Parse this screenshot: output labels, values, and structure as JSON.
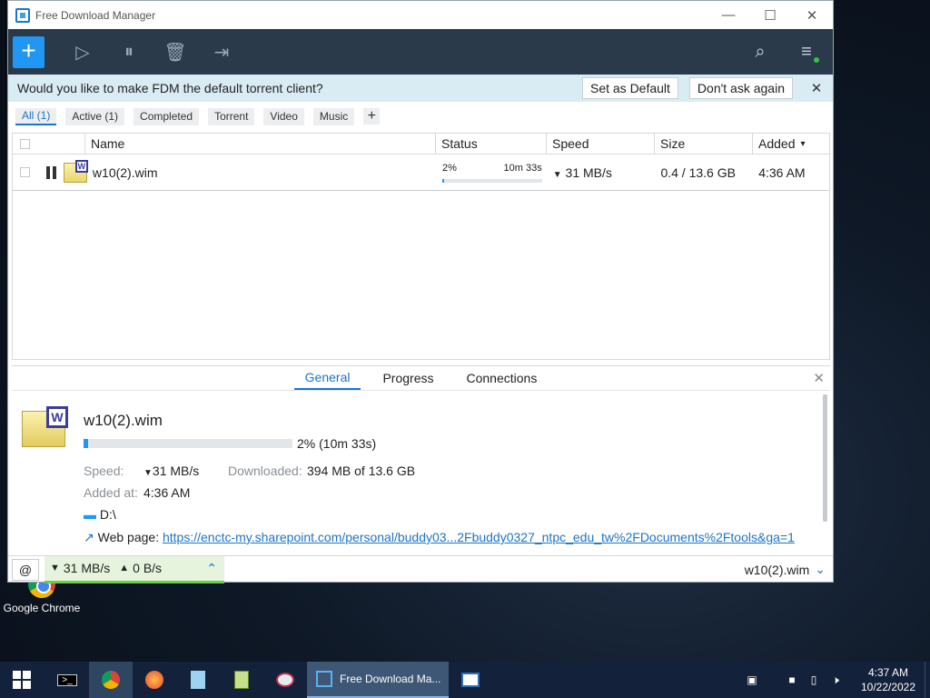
{
  "window": {
    "title": "Free Download Manager",
    "minimize": "—",
    "maximize": "☐",
    "close": "✕"
  },
  "toolbar": {
    "add": "+",
    "start": "▷",
    "pause_all": "⏸",
    "delete": "🗑",
    "move": "⇥",
    "search": "⌕",
    "menu": "≡"
  },
  "banner": {
    "message": "Would you like to make FDM the default torrent client?",
    "set_default": "Set as Default",
    "dont_ask": "Don't ask again",
    "close": "✕"
  },
  "filters": [
    {
      "label": "All (1)",
      "active": true
    },
    {
      "label": "Active (1)",
      "active": false
    },
    {
      "label": "Completed",
      "active": false
    },
    {
      "label": "Torrent",
      "active": false
    },
    {
      "label": "Video",
      "active": false
    },
    {
      "label": "Music",
      "active": false
    }
  ],
  "filter_add": "+",
  "table": {
    "headers": {
      "name": "Name",
      "status": "Status",
      "speed": "Speed",
      "size": "Size",
      "added": "Added"
    },
    "row": {
      "name": "w10(2).wim",
      "percent_text": "2%",
      "eta": "10m 33s",
      "progress": 0.02,
      "speed": "31 MB/s",
      "size": "0.4 / 13.6 GB",
      "added": "4:36 AM"
    }
  },
  "details": {
    "tabs": [
      "General",
      "Progress",
      "Connections"
    ],
    "file_name": "w10(2).wim",
    "progress": 0.02,
    "progress_text": "2% (10m 33s)",
    "speed_label": "Speed:",
    "speed_value": "31 MB/s",
    "downloaded_label": "Downloaded:",
    "downloaded_value": "394 MB of 13.6 GB",
    "added_label": "Added at:",
    "added_value": "4:36 AM",
    "folder": "D:\\",
    "web_label": "Web page:",
    "web_url": "https://enctc-my.sharepoint.com/personal/buddy03...2Fbuddy0327_ntpc_edu_tw%2FDocuments%2Ftools&ga=1"
  },
  "statusbar": {
    "down_speed": "31 MB/s",
    "up_speed": "0 B/s",
    "current_file": "w10(2).wim"
  },
  "desktop": {
    "icon_label": "Google Chrome"
  },
  "taskbar": {
    "active_app": "Free Download Ma...",
    "time": "4:37 AM",
    "date": "10/22/2022"
  }
}
